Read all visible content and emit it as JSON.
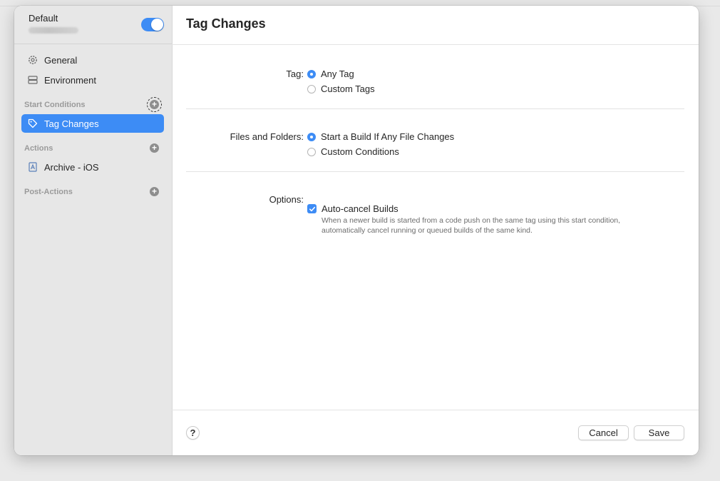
{
  "sidebar": {
    "workflow_title": "Default",
    "enabled": true,
    "items": [
      {
        "label": "General",
        "icon": "gear-icon"
      },
      {
        "label": "Environment",
        "icon": "server-icon"
      }
    ],
    "sections": [
      {
        "header": "Start Conditions",
        "items": [
          {
            "label": "Tag Changes",
            "icon": "tag-icon",
            "selected": true
          }
        ]
      },
      {
        "header": "Actions",
        "items": [
          {
            "label": "Archive - iOS",
            "icon": "archive-icon"
          }
        ]
      },
      {
        "header": "Post-Actions",
        "items": []
      }
    ],
    "add_symbol": "+"
  },
  "main": {
    "title": "Tag Changes",
    "tag": {
      "label": "Tag:",
      "options": [
        {
          "label": "Any Tag",
          "selected": true
        },
        {
          "label": "Custom Tags",
          "selected": false
        }
      ]
    },
    "files": {
      "label": "Files and Folders:",
      "options": [
        {
          "label": "Start a Build If Any File Changes",
          "selected": true
        },
        {
          "label": "Custom Conditions",
          "selected": false
        }
      ]
    },
    "options": {
      "label": "Options:",
      "auto_cancel_label": "Auto-cancel Builds",
      "auto_cancel_checked": true,
      "help": "When a newer build is started from a code push on the same tag using this start condition, automatically cancel running or queued builds of the same kind."
    }
  },
  "footer": {
    "help_symbol": "?",
    "cancel_label": "Cancel",
    "save_label": "Save"
  },
  "colors": {
    "accent": "#3d8cf5",
    "sidebar_bg": "#e7e7e7",
    "section_header": "#9a9a9a"
  }
}
